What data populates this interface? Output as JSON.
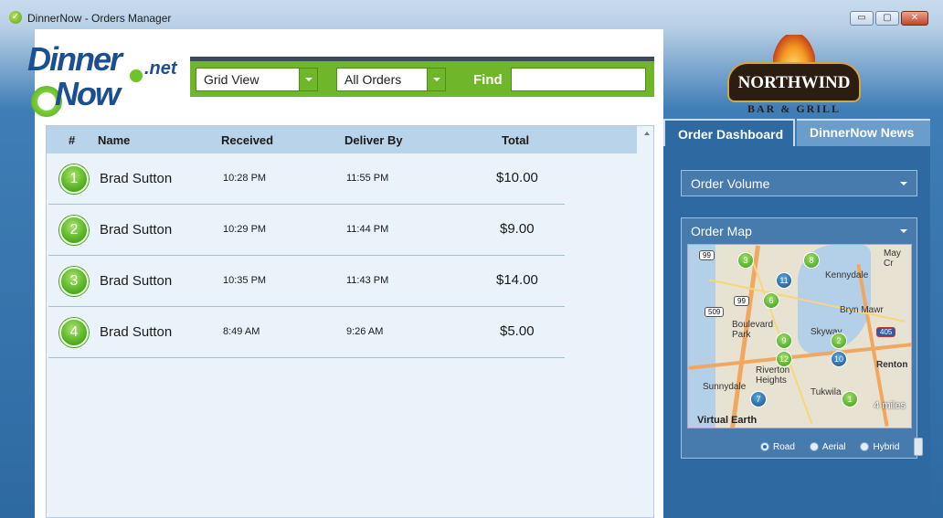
{
  "window": {
    "title": "DinnerNow - Orders Manager",
    "minimize": "▭",
    "maximize": "▢",
    "close": "✕"
  },
  "logo": {
    "line1": "Dinner",
    "line2": "Now",
    "suffix": ".net"
  },
  "toolbar": {
    "view_select": "Grid View",
    "filter_select": "All Orders",
    "find_label": "Find",
    "find_value": ""
  },
  "grid": {
    "columns": [
      "#",
      "Name",
      "Received",
      "Deliver By",
      "Total"
    ],
    "rows": [
      {
        "num": "1",
        "name": "Brad Sutton",
        "received": "10:28 PM",
        "deliver_by": "11:55 PM",
        "total": "$10.00"
      },
      {
        "num": "2",
        "name": "Brad Sutton",
        "received": "10:29 PM",
        "deliver_by": "11:44 PM",
        "total": "$9.00"
      },
      {
        "num": "3",
        "name": "Brad Sutton",
        "received": "10:35 PM",
        "deliver_by": "11:43 PM",
        "total": "$14.00"
      },
      {
        "num": "4",
        "name": "Brad Sutton",
        "received": "8:49 AM",
        "deliver_by": "9:26 AM",
        "total": "$5.00"
      }
    ]
  },
  "restaurant": {
    "name": "NORTHWIND",
    "subtitle": "BAR & GRILL"
  },
  "tabs": {
    "active": "Order Dashboard",
    "inactive": "DinnerNow News"
  },
  "panels": {
    "volume": "Order Volume",
    "map": "Order Map"
  },
  "map": {
    "labels": [
      "Kennydale",
      "Bryn Mawr",
      "Boulevard Park",
      "Skyway",
      "Riverton Heights",
      "Renton",
      "Sunnydale",
      "Tukwila",
      "May Cr"
    ],
    "pins": [
      "3",
      "8",
      "11",
      "6",
      "9",
      "12",
      "2",
      "10",
      "7",
      "1"
    ],
    "shields": [
      "99",
      "99",
      "509",
      "405"
    ],
    "copyright": "Virtual Earth",
    "scale": "4 miles"
  },
  "map_modes": {
    "road": "Road",
    "aerial": "Aerial",
    "hybrid": "Hybrid",
    "selected": "Road"
  }
}
